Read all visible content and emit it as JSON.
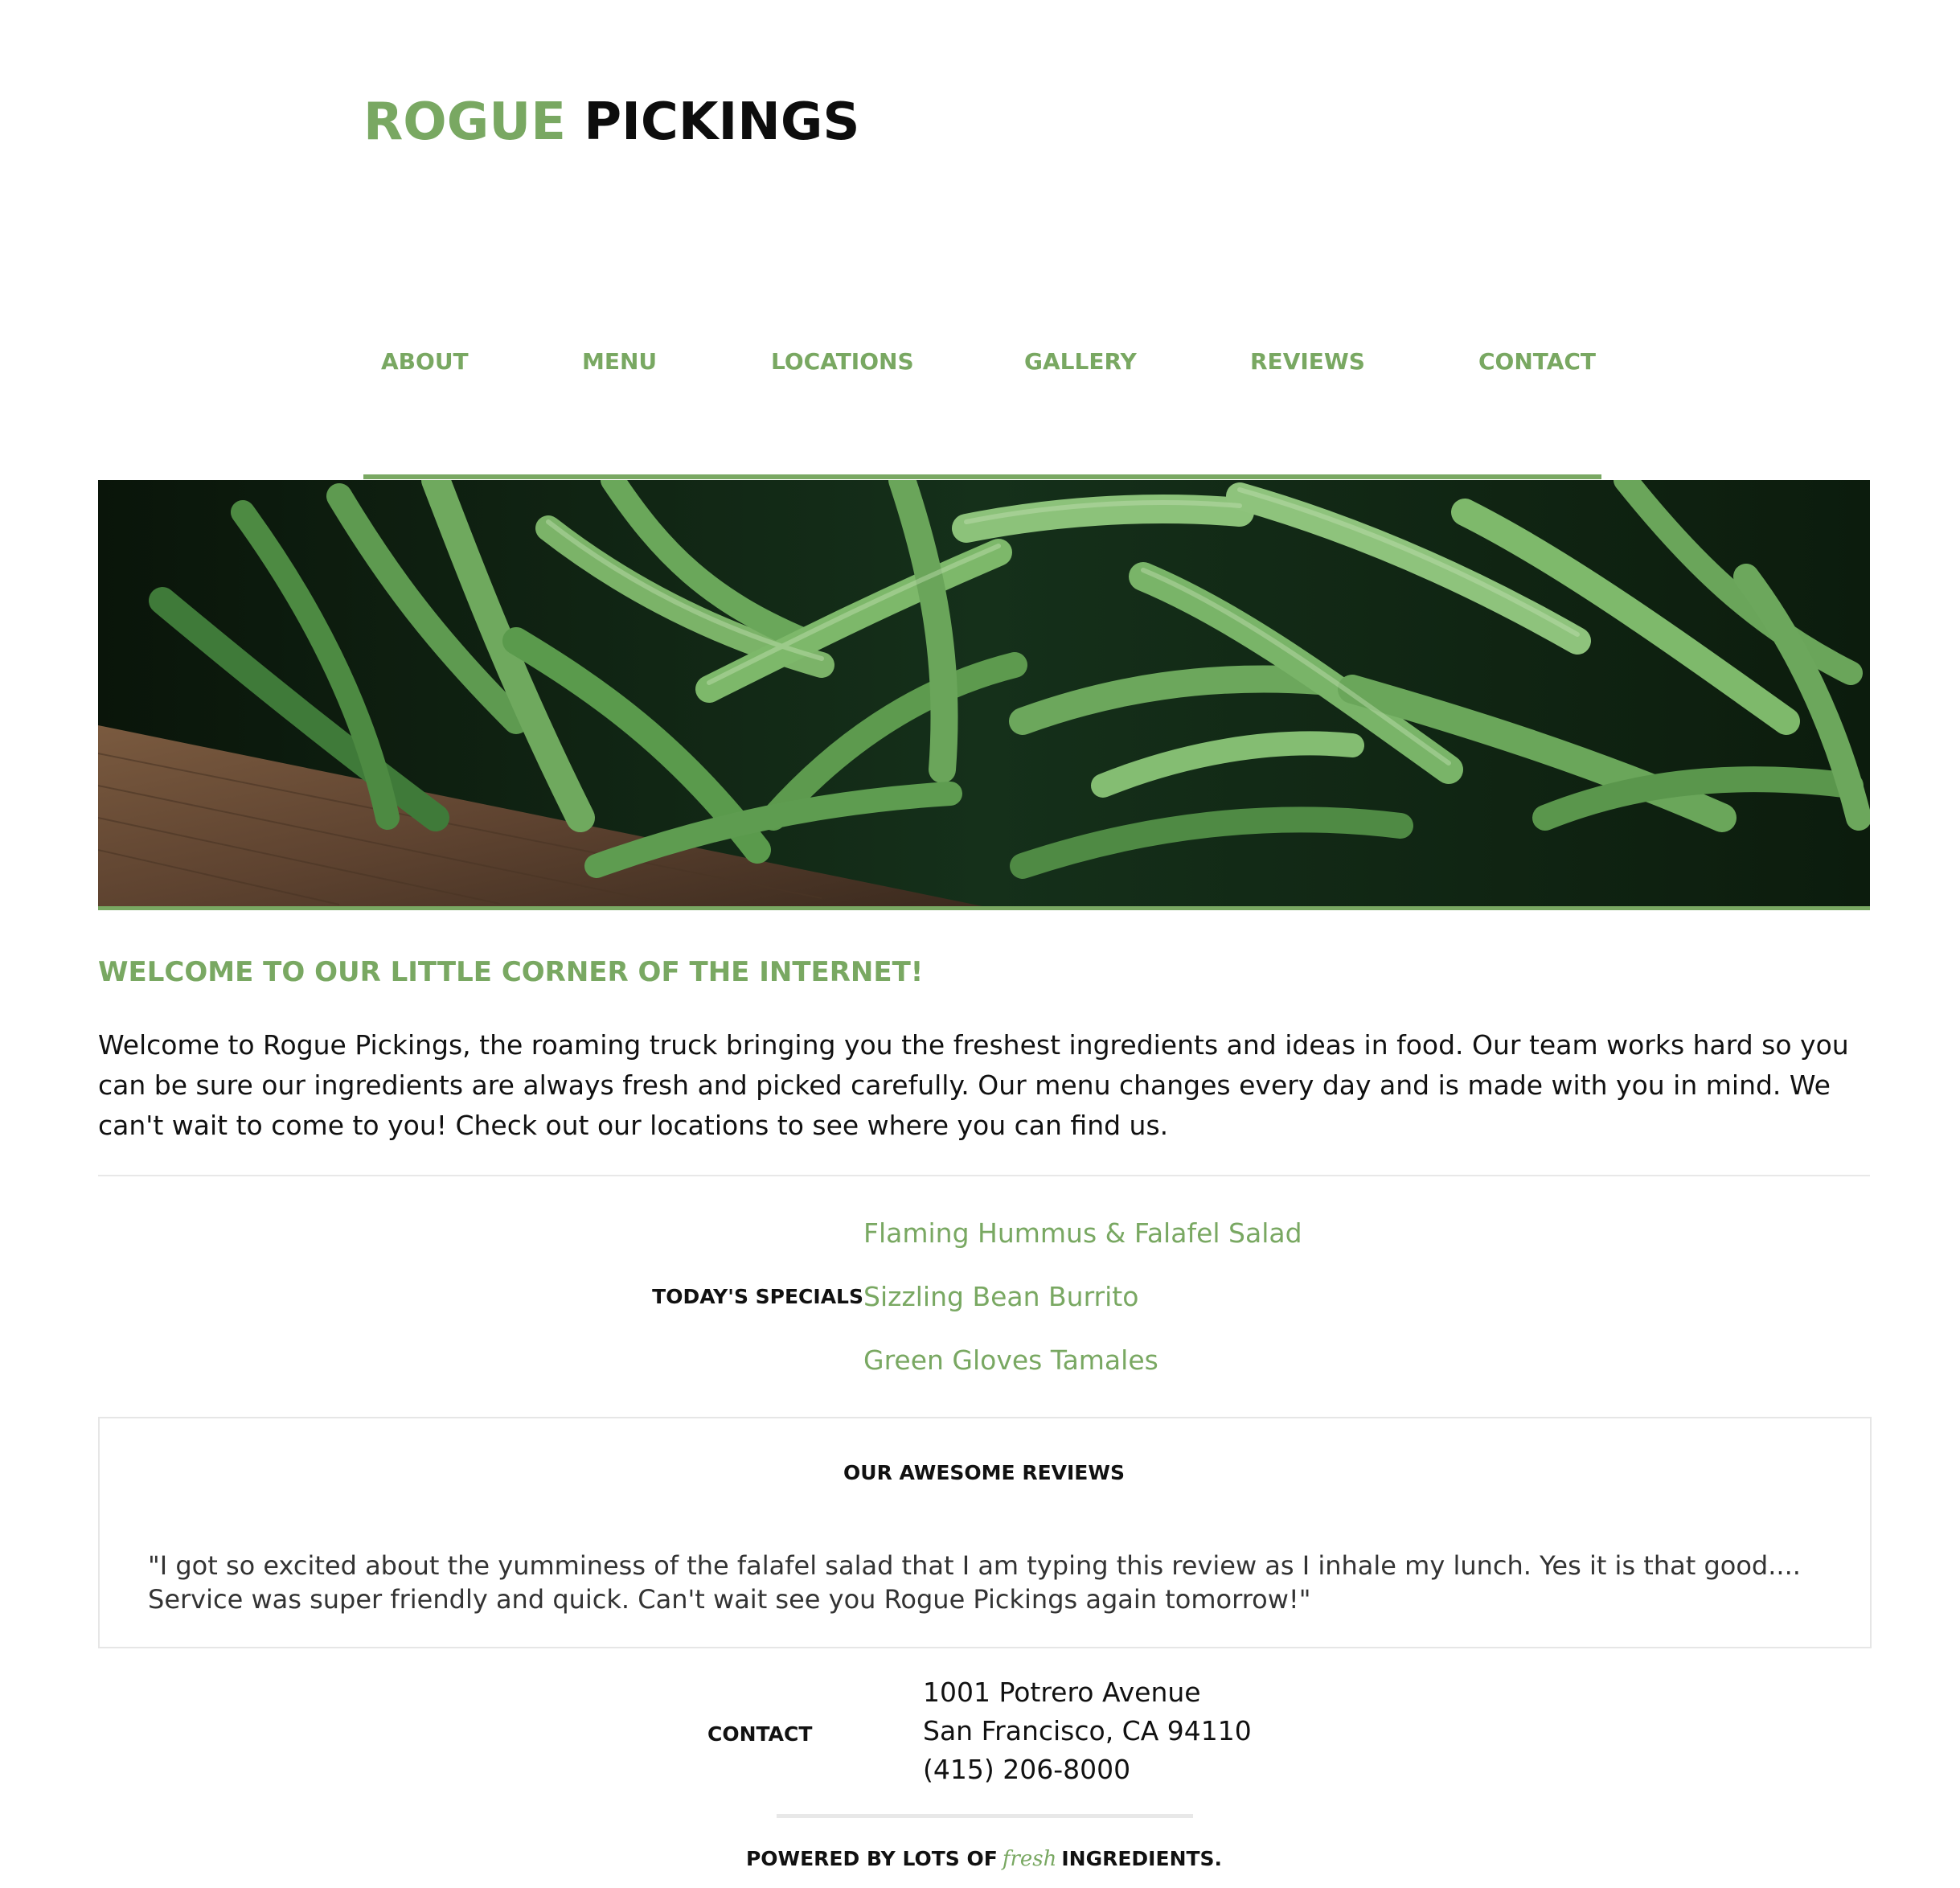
{
  "header": {
    "logo_green": "ROGUE",
    "logo_dark": "PICKINGS"
  },
  "nav": {
    "items": [
      {
        "label": "ABOUT"
      },
      {
        "label": "MENU"
      },
      {
        "label": "LOCATIONS"
      },
      {
        "label": "GALLERY"
      },
      {
        "label": "REVIEWS"
      },
      {
        "label": "CONTACT"
      }
    ]
  },
  "welcome": {
    "title": "WELCOME TO OUR LITTLE CORNER OF THE INTERNET!",
    "body": "Welcome to Rogue Pickings, the roaming truck bringing you the freshest ingredients and ideas in food. Our team works hard so you can be sure our ingredients are always fresh and picked carefully. Our menu changes every day and is made with you in mind. We can't wait to come to you! Check out our locations to see where you can find us."
  },
  "specials": {
    "label": "TODAY'S SPECIALS",
    "items": [
      "Flaming Hummus & Falafel Salad",
      "Sizzling Bean Burrito",
      "Green Gloves Tamales"
    ]
  },
  "reviews": {
    "title": "OUR AWESOME REVIEWS",
    "quote": "\"I got so excited about the yumminess of the falafel salad that I am typing this review as I inhale my lunch. Yes it is that good.... Service was super friendly and quick. Can't wait see you Rogue Pickings again tomorrow!\""
  },
  "contact": {
    "label": "CONTACT",
    "address_line1": "1001 Potrero Avenue",
    "address_line2": "San Francisco, CA 94110",
    "phone": "(415) 206-8000"
  },
  "footer": {
    "prefix": "POWERED BY LOTS OF",
    "fresh": "fresh",
    "suffix": "INGREDIENTS."
  },
  "colors": {
    "accent": "#79a862",
    "text": "#111111",
    "background": "#ffffff"
  }
}
